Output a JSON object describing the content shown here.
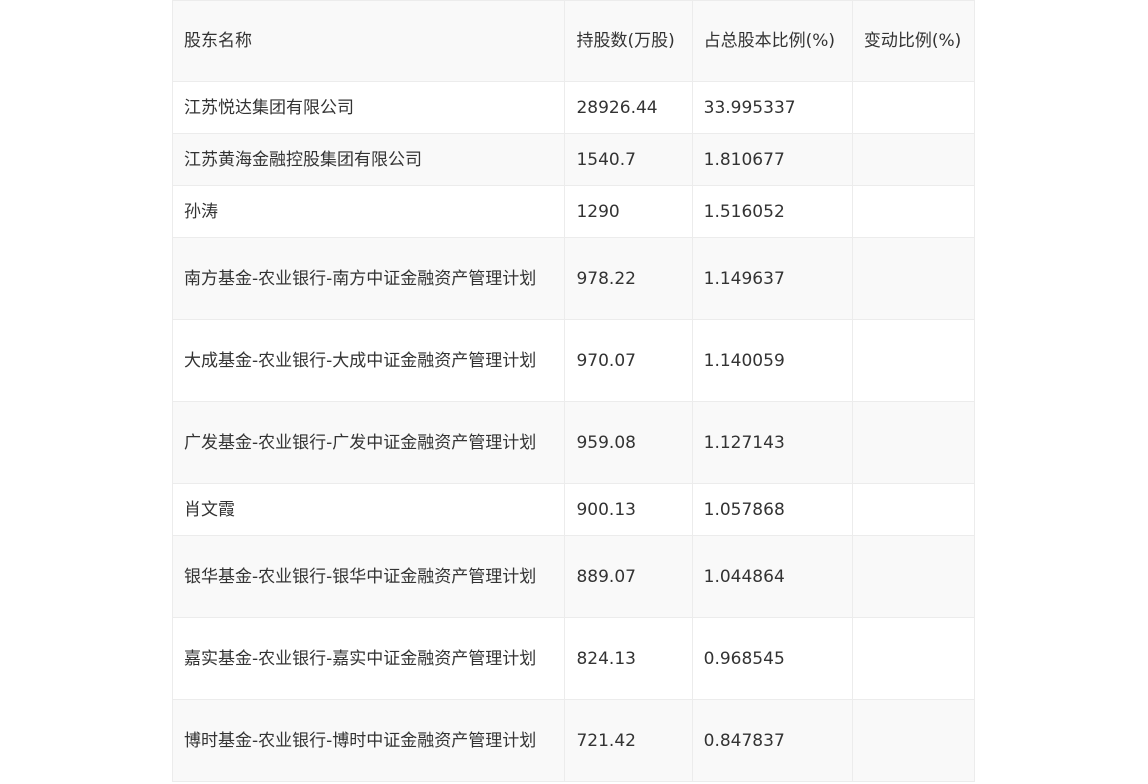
{
  "table": {
    "headers": {
      "name": "股东名称",
      "shares": "持股数(万股)",
      "ratio": "占总股本比例(%)",
      "change": "变动比例(%)"
    },
    "rows": [
      {
        "name": "江苏悦达集团有限公司",
        "shares": "28926.44",
        "ratio": "33.995337",
        "change": ""
      },
      {
        "name": "江苏黄海金融控股集团有限公司",
        "shares": "1540.7",
        "ratio": "1.810677",
        "change": ""
      },
      {
        "name": "孙涛",
        "shares": "1290",
        "ratio": "1.516052",
        "change": ""
      },
      {
        "name": "南方基金-农业银行-南方中证金融资产管理计划",
        "shares": "978.22",
        "ratio": "1.149637",
        "change": ""
      },
      {
        "name": "大成基金-农业银行-大成中证金融资产管理计划",
        "shares": "970.07",
        "ratio": "1.140059",
        "change": ""
      },
      {
        "name": "广发基金-农业银行-广发中证金融资产管理计划",
        "shares": "959.08",
        "ratio": "1.127143",
        "change": ""
      },
      {
        "name": "肖文霞",
        "shares": "900.13",
        "ratio": "1.057868",
        "change": ""
      },
      {
        "name": "银华基金-农业银行-银华中证金融资产管理计划",
        "shares": "889.07",
        "ratio": "1.044864",
        "change": ""
      },
      {
        "name": "嘉实基金-农业银行-嘉实中证金融资产管理计划",
        "shares": "824.13",
        "ratio": "0.968545",
        "change": ""
      },
      {
        "name": "博时基金-农业银行-博时中证金融资产管理计划",
        "shares": "721.42",
        "ratio": "0.847837",
        "change": ""
      }
    ]
  }
}
